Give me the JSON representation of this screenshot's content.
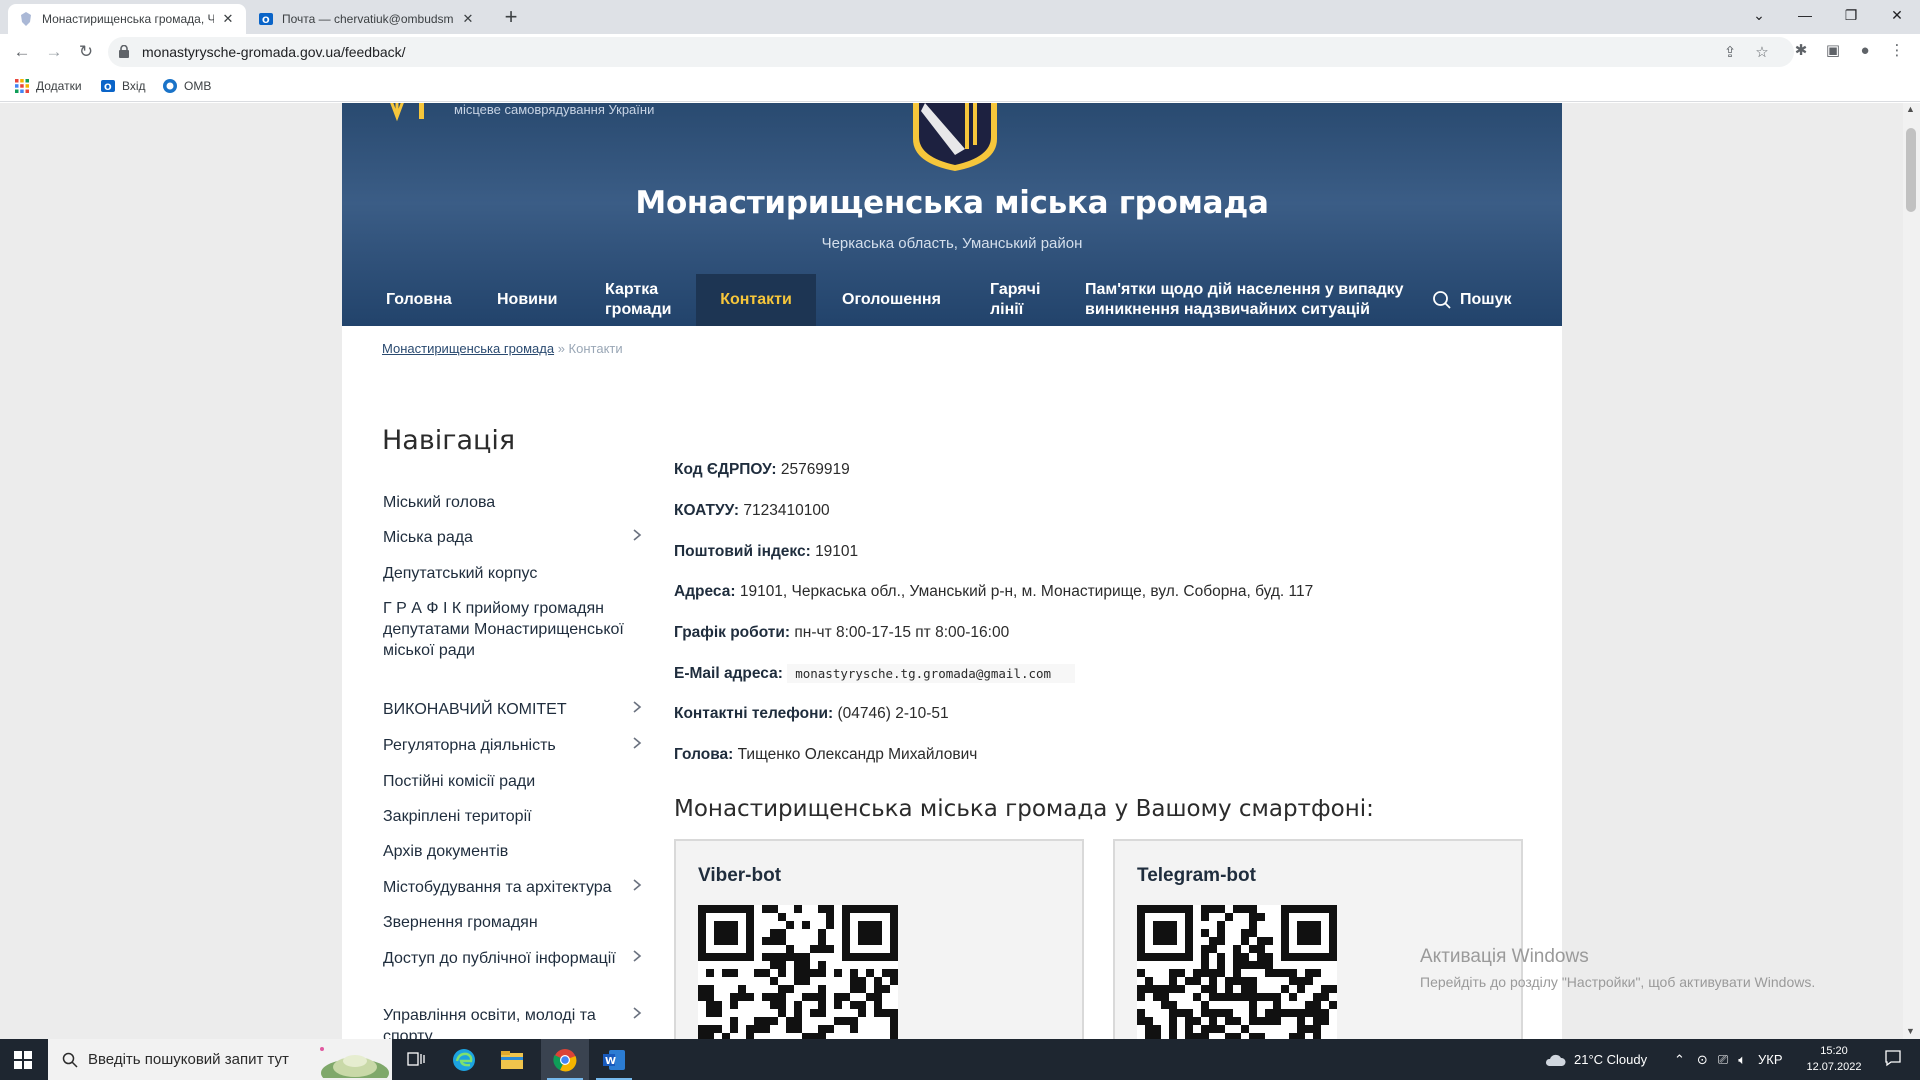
{
  "browser": {
    "tabs": [
      {
        "title": "Монастирищенська громада, Ч",
        "active": true
      },
      {
        "title": "Почта — chervatiuk@ombudsma",
        "active": false
      }
    ],
    "url": "monastyrysche-gromada.gov.ua/feedback/",
    "bookmarks": [
      {
        "label": "Додатки",
        "icon": "apps-grid-icon"
      },
      {
        "label": "Вхід",
        "icon": "outlook-icon"
      },
      {
        "label": "OMB",
        "icon": "omb-icon"
      }
    ]
  },
  "site": {
    "gov_text": "місцеве самоврядування України",
    "title": "Монастирищенська міська громада",
    "subtitle": "Черкаська область, Уманський район",
    "menu": [
      {
        "label": "Головна"
      },
      {
        "label": "Новини"
      },
      {
        "label": "Картка громади"
      },
      {
        "label": "Контакти",
        "active": true
      },
      {
        "label": "Оголошення"
      },
      {
        "label": "Гарячі лінії"
      },
      {
        "label": "Пам'ятки щодо дій населення у випадку виникнення надзвичайних ситуацій"
      }
    ],
    "search_label": "Пошук",
    "accent_color": "#f6c63b",
    "header_color": "#2f527c"
  },
  "breadcrumb": {
    "home": "Монастирищенська громада",
    "separator": "»",
    "current": "Контакти"
  },
  "sidebar": {
    "title": "Навігація",
    "items": [
      {
        "label": "Міський голова",
        "has_children": false
      },
      {
        "label": "Міська рада",
        "has_children": true
      },
      {
        "label": "Депутатський корпус",
        "has_children": false
      },
      {
        "label": "Г Р А Ф І К прийому громадян депутатами Монастирищенської міської ради",
        "has_children": false
      },
      {
        "label": "ВИКОНАВЧИЙ КОМІТЕТ",
        "has_children": true
      },
      {
        "label": "Регуляторна діяльність",
        "has_children": true
      },
      {
        "label": "Постійні комісії ради",
        "has_children": false
      },
      {
        "label": "Закріплені території",
        "has_children": false
      },
      {
        "label": "Архів документів",
        "has_children": false
      },
      {
        "label": "Містобудування та архітектура",
        "has_children": true
      },
      {
        "label": "Звернення громадян",
        "has_children": false
      },
      {
        "label": "Доступ до публічної інформації",
        "has_children": true
      },
      {
        "label": "Управління освіти, молоді та спорту",
        "has_children": true
      }
    ]
  },
  "contacts": {
    "edrpou": {
      "label": "Код ЄДРПОУ:",
      "value": "25769919"
    },
    "koatuu": {
      "label": "КОАТУУ:",
      "value": "7123410100"
    },
    "postal": {
      "label": "Поштовий індекс:",
      "value": "19101"
    },
    "address": {
      "label": "Адреса:",
      "value": "19101, Черкаська обл., Уманський р-н, м. Монастирище, вул. Соборна, буд. 117"
    },
    "schedule": {
      "label": "Графік роботи:",
      "value": "пн-чт 8:00-17-15 пт 8:00-16:00"
    },
    "email": {
      "label": "E-Mail адреса:",
      "value": "monastyrysche.tg.gromada@gmail.com"
    },
    "phones": {
      "label": "Контактні телефони:",
      "value": "(04746) 2-10-51"
    },
    "head": {
      "label": "Голова:",
      "value": "Тищенко Олександр Михайлович"
    }
  },
  "smartphone": {
    "title": "Монастирищенська міська громада у Вашому смартфоні:",
    "bots": [
      {
        "title": "Viber-bot"
      },
      {
        "title": "Telegram-bot"
      }
    ]
  },
  "windows_watermark": {
    "line1": "Активація Windows",
    "line2": "Перейдіть до розділу \"Настройки\", щоб активувати Windows."
  },
  "taskbar": {
    "search_placeholder": "Введіть пошуковий запит тут",
    "weather": "21°C  Cloudy",
    "language": "УКР",
    "time": "15:20",
    "date": "12.07.2022"
  }
}
